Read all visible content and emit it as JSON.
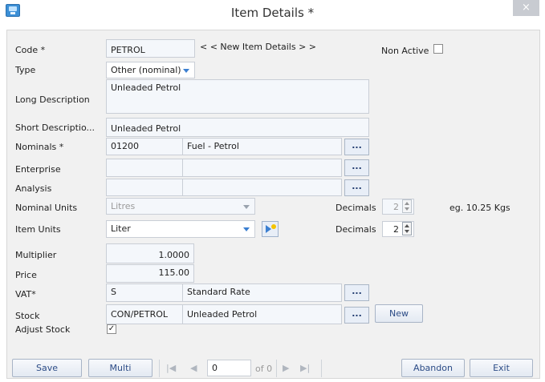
{
  "window": {
    "title": "Item Details *",
    "close": "×"
  },
  "labels": {
    "code": "Code *",
    "type": "Type",
    "long_description": "Long Description",
    "short_description": "Short Descriptio...",
    "nominals": "Nominals *",
    "enterprise": "Enterprise",
    "analysis": "Analysis",
    "nominal_units": "Nominal Units",
    "item_units": "Item Units",
    "multiplier": "Multiplier",
    "price": "Price",
    "vat": "VAT*",
    "stock": "Stock",
    "adjust_stock": "Adjust Stock",
    "non_active": "Non Active",
    "new_item": "< < New Item Details > >",
    "decimals_1": "Decimals",
    "decimals_2": "Decimals",
    "example": "eg. 10.25 Kgs"
  },
  "values": {
    "code": "PETROL",
    "type": "Other (nominal)",
    "long_description": "Unleaded Petrol",
    "short_description": "Unleaded Petrol",
    "nominal_code": "01200",
    "nominal_name": "Fuel - Petrol",
    "enterprise_code": "",
    "enterprise_name": "",
    "analysis_code": "",
    "analysis_name": "",
    "nominal_units": "Litres",
    "item_units": "Liter",
    "decimals_1": "2",
    "decimals_2": "2",
    "multiplier": "1.0000",
    "price": "115.00",
    "vat_code": "S",
    "vat_name": "Standard Rate",
    "stock_code": "CON/PETROL",
    "stock_name": "Unleaded Petrol",
    "non_active_checked": false,
    "adjust_stock_checked": true,
    "adjust_stock_mark": "✓",
    "record_number": "0",
    "record_of": "of 0"
  },
  "buttons": {
    "ellipsis": "...",
    "new": "New",
    "save": "Save",
    "multi": "Multi",
    "abandon": "Abandon",
    "exit": "Exit"
  },
  "nav": {
    "first": "|◀",
    "prev": "◀",
    "next": "▶",
    "last": "▶|"
  }
}
